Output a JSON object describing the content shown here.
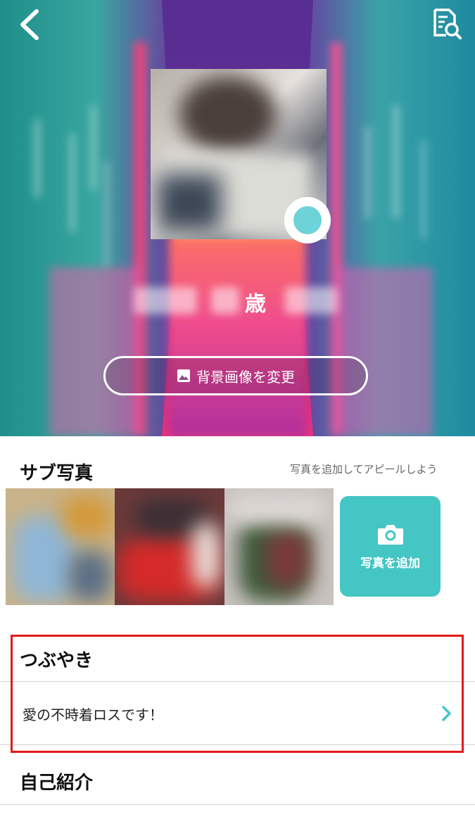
{
  "header": {
    "back_icon": "chevron-left-icon",
    "search_icon": "document-search-icon"
  },
  "profile": {
    "age_suffix": "歳",
    "change_bg_label": "背景画像を変更",
    "change_bg_icon": "image-icon"
  },
  "sub_photos": {
    "title": "サブ写真",
    "hint": "写真を追加してアピールしよう",
    "add_label": "写真を追加",
    "add_icon": "camera-icon",
    "accent": "#44c6c5"
  },
  "tweet": {
    "title": "つぶやき",
    "text": "愛の不時着ロスです！",
    "chevron_icon": "chevron-right-icon",
    "highlight_color": "#e41919"
  },
  "intro": {
    "title": "自己紹介"
  }
}
